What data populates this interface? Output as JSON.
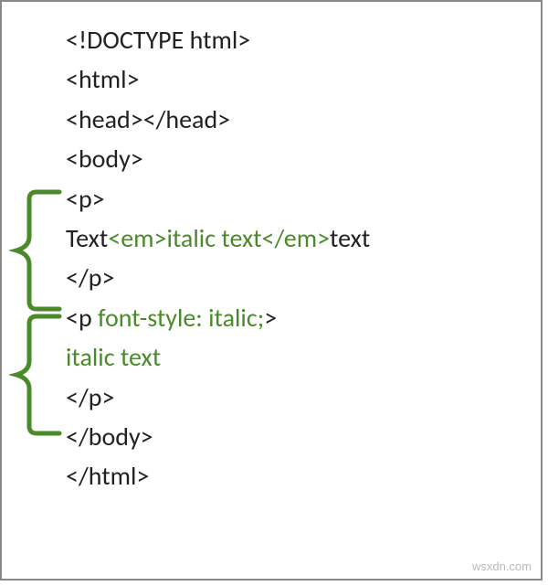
{
  "code": {
    "l1": "<!DOCTYPE html>",
    "l2": "<html>",
    "l3": "<head></head>",
    "l4": "<body>",
    "l5_open": "<p>",
    "l6_a": "Text",
    "l6_b": "<em>",
    "l6_c": "italic text",
    "l6_d": "</em>",
    "l6_e": "text",
    "l7_close": "</p>",
    "l8_a": "<p ",
    "l8_b": "font-style: italic;",
    "l8_c": ">",
    "l9": "italic text",
    "l10_close": "</p>",
    "l11": "</body>",
    "l12": "</html>"
  },
  "watermark": "wsxdn.com",
  "colors": {
    "bracket": "#4a8a2a",
    "tag": "#4a8a2a",
    "text": "#222222"
  }
}
